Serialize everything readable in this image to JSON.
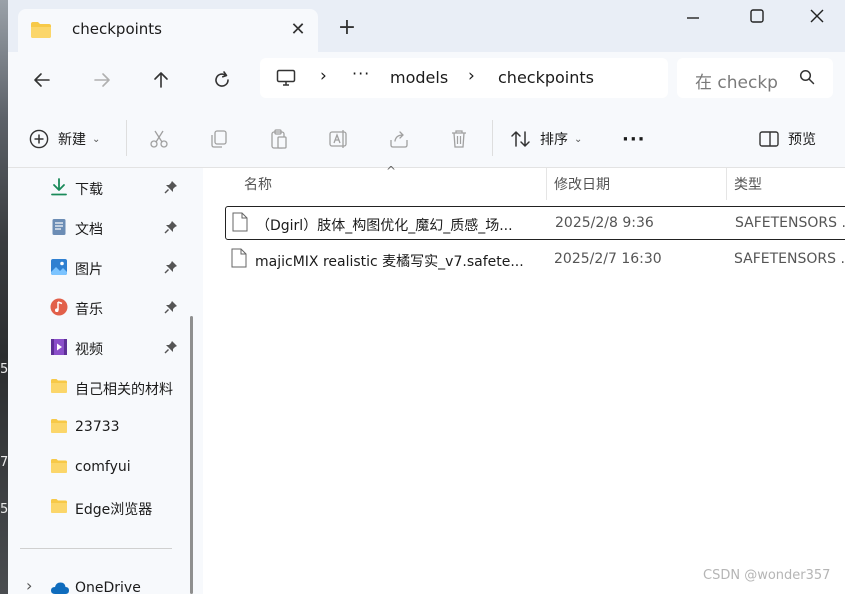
{
  "tab": {
    "title": "checkpoints",
    "close": "✕"
  },
  "new_tab": "+",
  "window_controls": {
    "minimize": "—",
    "maximize": "☐",
    "close": "✕"
  },
  "address": {
    "crumbs": [
      "models",
      "checkpoints"
    ],
    "more": "···",
    "sep": "›"
  },
  "search": {
    "placeholder": "在 checkpoints 中搜索"
  },
  "commands": {
    "new_label": "新建",
    "sort_label": "排序",
    "more": "···",
    "preview_label": "预览"
  },
  "sidebar": {
    "items": [
      {
        "label": "下载",
        "icon": "download-icon",
        "pinned": true
      },
      {
        "label": "文档",
        "icon": "document-icon",
        "pinned": true
      },
      {
        "label": "图片",
        "icon": "picture-icon",
        "pinned": true
      },
      {
        "label": "音乐",
        "icon": "music-icon",
        "pinned": true
      },
      {
        "label": "视频",
        "icon": "video-icon",
        "pinned": true
      },
      {
        "label": "自己相关的材料",
        "icon": "folder-icon",
        "pinned": false
      },
      {
        "label": "23733",
        "icon": "folder-icon",
        "pinned": false
      },
      {
        "label": "comfyui",
        "icon": "folder-icon",
        "pinned": false
      },
      {
        "label": "Edge浏览器",
        "icon": "folder-icon",
        "pinned": false
      }
    ],
    "onedrive": {
      "label": "OneDrive",
      "expand": "›"
    }
  },
  "columns": {
    "name": "名称",
    "modified": "修改日期",
    "type": "类型"
  },
  "files": [
    {
      "name": "（Dgirl）肢体_构图优化_魔幻_质感_场...",
      "modified": "2025/2/8 9:36",
      "type": "SAFETENSORS ...",
      "selected": true
    },
    {
      "name": "majicMIX realistic 麦橘写实_v7.safete...",
      "modified": "2025/2/7 16:30",
      "type": "SAFETENSORS ...",
      "selected": false
    }
  ],
  "desktop_strip": [
    "5",
    "7",
    "5"
  ],
  "watermark": "CSDN @wonder357",
  "colors": {
    "accent": "#0067c0",
    "folder": "#f7c948",
    "window_bg": "#e9eef6",
    "pane_bg": "#f7f9fc"
  }
}
